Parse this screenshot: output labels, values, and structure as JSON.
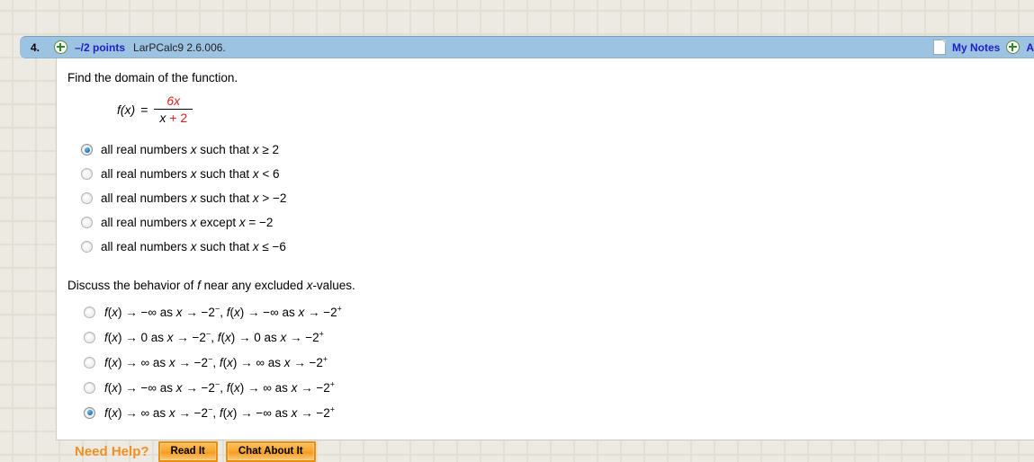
{
  "header": {
    "question_number": "4.",
    "expand_icon": "plus-circle-icon",
    "points": "–/2 points",
    "question_code": "LarPCalc9 2.6.006.",
    "notes_icon": "document-icon",
    "my_notes_label": "My Notes",
    "add_icon": "plus-circle-icon",
    "ask_teacher_label": "A",
    "bar_color": "#9cc3e2",
    "link_color": "#2020c0"
  },
  "question1": {
    "prompt": "Find the domain of the function.",
    "formula": {
      "function_name": "f",
      "variable": "(x)",
      "equals": "=",
      "numerator": "6x",
      "denominator_black": "x",
      "denominator_red": " + 2",
      "accent_color": "#e21b1b"
    },
    "options": [
      {
        "text": "all real numbers x such that x ≥ 2",
        "selected": true
      },
      {
        "text": "all real numbers x such that x < 6",
        "selected": false
      },
      {
        "text": "all real numbers x such that x > −2",
        "selected": false
      },
      {
        "text": "all real numbers x except x = −2",
        "selected": false
      },
      {
        "text": "all real numbers x such that x ≤ −6",
        "selected": false
      }
    ]
  },
  "question2": {
    "prompt": "Discuss the behavior of f near any excluded x-values.",
    "options": [
      {
        "text": "f(x) → −∞ as x → −2⁻, f(x) → −∞ as x → −2⁺",
        "selected": false
      },
      {
        "text": "f(x) → 0 as x → −2⁻, f(x) → 0 as x → −2⁺",
        "selected": false
      },
      {
        "text": "f(x) → ∞ as x → −2⁻, f(x) → ∞ as x → −2⁺",
        "selected": false
      },
      {
        "text": "f(x) → −∞ as x → −2⁻, f(x) → ∞ as x → −2⁺",
        "selected": false
      },
      {
        "text": "f(x) → ∞ as x → −2⁻, f(x) → −∞ as x → −2⁺",
        "selected": true
      }
    ]
  },
  "need_help": {
    "label": "Need Help?",
    "read_it_label": "Read It",
    "chat_label": "Chat About It",
    "accent_color": "#f28f21"
  }
}
